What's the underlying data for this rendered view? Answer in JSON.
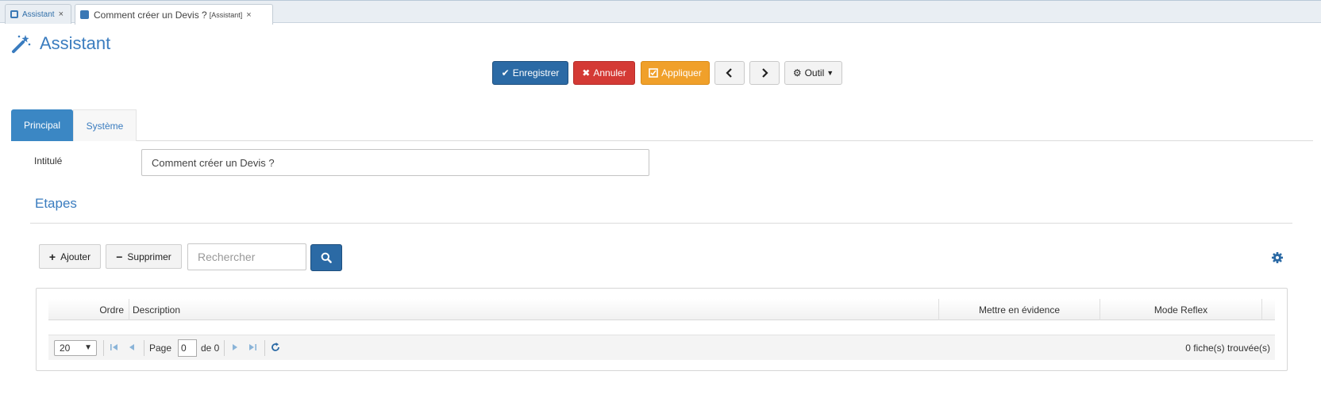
{
  "top_tabs": [
    {
      "label": "Assistant",
      "close": "×"
    },
    {
      "label": "Comment créer un Devis ?",
      "suffix": "[Assistant]",
      "close": "×"
    }
  ],
  "page": {
    "title": "Assistant",
    "icon": "magic-wand-icon"
  },
  "toolbar": {
    "save_label": "Enregistrer",
    "cancel_label": "Annuler",
    "apply_label": "Appliquer",
    "tool_label": "Outil"
  },
  "content_tabs": [
    {
      "label": "Principal",
      "active": true
    },
    {
      "label": "Système",
      "active": false
    }
  ],
  "form": {
    "intitule_label": "Intitulé",
    "intitule_value": "Comment créer un Devis ?"
  },
  "steps": {
    "title": "Etapes",
    "add_label": "Ajouter",
    "delete_label": "Supprimer",
    "search_placeholder": "Rechercher",
    "columns": [
      "Ordre",
      "Description",
      "Mettre en évidence",
      "Mode Reflex"
    ],
    "rows": [],
    "pager": {
      "page_size": "20",
      "page_label": "Page",
      "page_value": "0",
      "of_label": "de 0",
      "count_text": "0 fiche(s) trouvée(s)"
    }
  },
  "colors": {
    "primary": "#2b6aa5",
    "danger": "#d43a35",
    "warning": "#f0a02a",
    "tab_active": "#3b87c4",
    "title": "#3a7cbf"
  }
}
